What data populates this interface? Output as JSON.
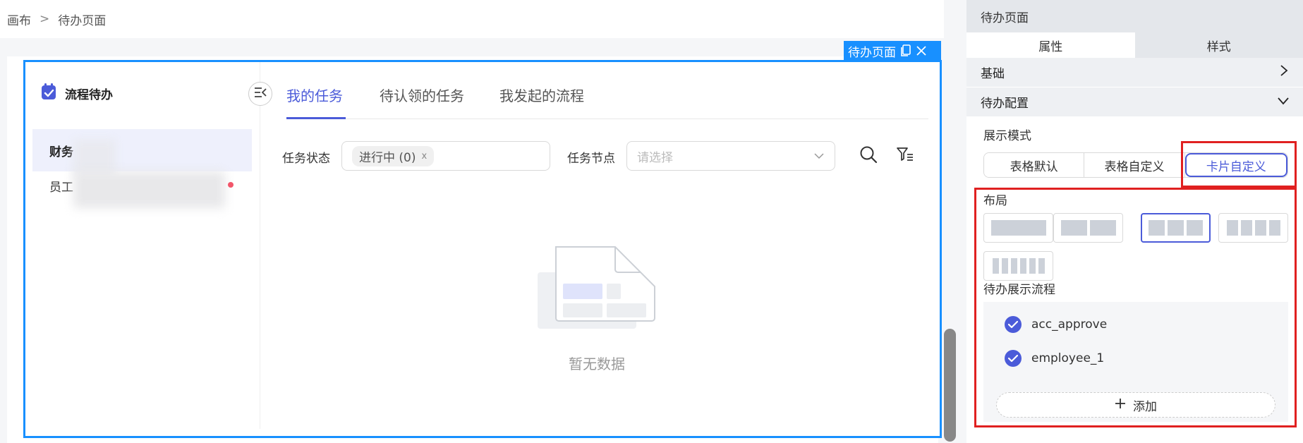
{
  "breadcrumb": {
    "root": "画布",
    "separator": ">",
    "current": "待办页面"
  },
  "selection": {
    "tag_label": "待办页面"
  },
  "widget": {
    "header_title": "流程待办",
    "categories": [
      {
        "label": "财务"
      },
      {
        "label": "员工"
      }
    ],
    "tabs": [
      {
        "label": "我的任务"
      },
      {
        "label": "待认领的任务"
      },
      {
        "label": "我发起的流程"
      }
    ],
    "filters": {
      "status_label": "任务状态",
      "status_chip": "进行中 (0)",
      "status_chip_close": "x",
      "node_label": "任务节点",
      "node_placeholder": "请选择"
    },
    "empty_text": "暂无数据"
  },
  "panel": {
    "title": "待办页面",
    "tabs": [
      {
        "label": "属性"
      },
      {
        "label": "样式"
      }
    ],
    "sections": {
      "basic": "基础",
      "todo_config": "待办配置"
    },
    "display_mode": {
      "label": "展示模式",
      "options": [
        {
          "label": "表格默认"
        },
        {
          "label": "表格自定义"
        },
        {
          "label": "卡片自定义"
        }
      ],
      "selected": "卡片自定义"
    },
    "layout": {
      "label": "布局",
      "column_options": [
        1,
        2,
        3,
        4,
        6
      ],
      "selected_columns": 3
    },
    "flows": {
      "label": "待办展示流程",
      "items": [
        {
          "label": "acc_approve"
        },
        {
          "label": "employee_1"
        }
      ],
      "add_label": "添加"
    }
  },
  "colors": {
    "accent": "#4b5bd9",
    "selection": "#1890ff",
    "highlight": "#e02020",
    "badge": "#f2566a"
  }
}
